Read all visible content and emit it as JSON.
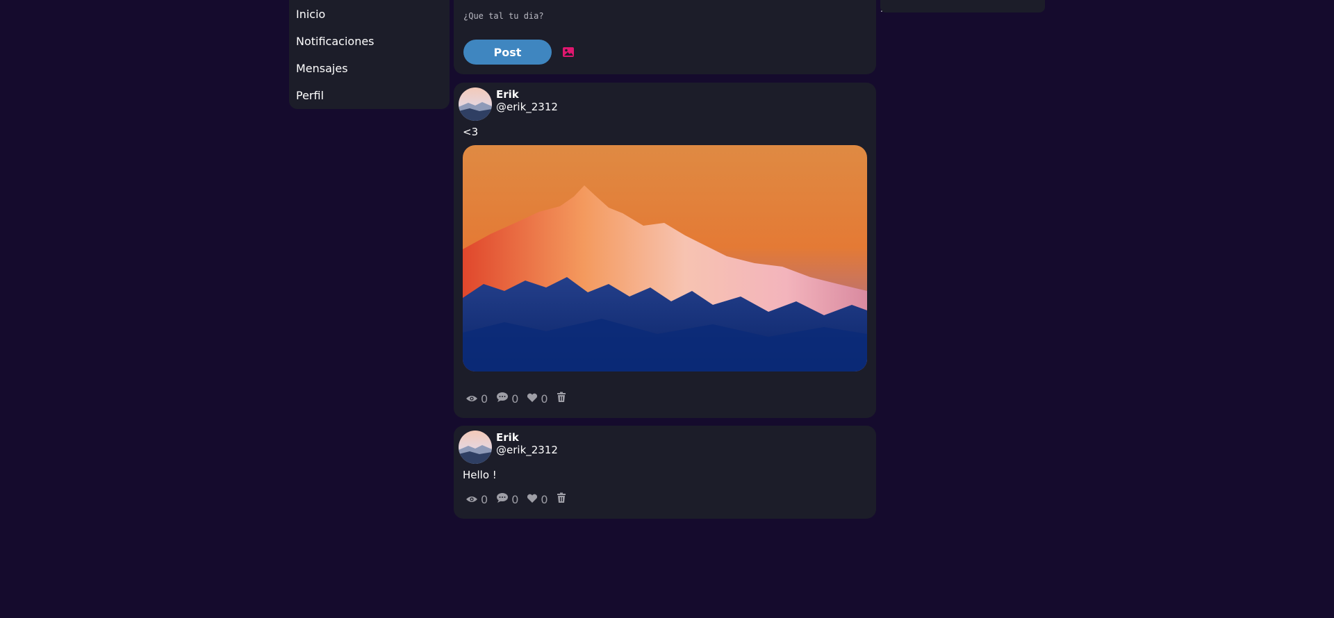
{
  "sidebar": {
    "items": [
      {
        "label": "Inicio"
      },
      {
        "label": "Notificaciones"
      },
      {
        "label": "Mensajes"
      },
      {
        "label": "Perfil"
      }
    ]
  },
  "composer": {
    "placeholder": "¿Que tal tu dia?",
    "post_label": "Post",
    "image_icon": "image-icon"
  },
  "right_panel": {
    "text": "."
  },
  "posts": [
    {
      "author": "Erik",
      "handle": "@erik_2312",
      "text": "<3",
      "has_image": true,
      "views": "0",
      "comments": "0",
      "likes": "0"
    },
    {
      "author": "Erik",
      "handle": "@erik_2312",
      "text": "Hello !",
      "has_image": false,
      "views": "0",
      "comments": "0",
      "likes": "0"
    }
  ],
  "colors": {
    "background": "#150b2d",
    "card": "#1c1d29",
    "accent": "#3f86c0",
    "image_icon": "#e0176f",
    "muted": "#9e9ea6"
  }
}
